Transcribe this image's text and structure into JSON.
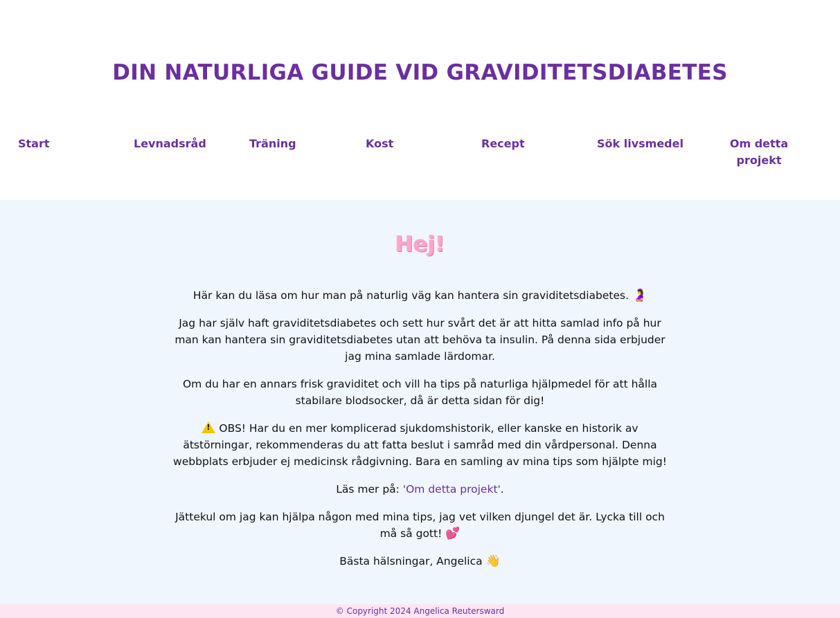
{
  "header": {
    "title": "DIN NATURLIGA GUIDE VID GRAVIDITETSDIABETES"
  },
  "nav": {
    "items": [
      {
        "label": "Start"
      },
      {
        "label": "Levnadsråd"
      },
      {
        "label": "Träning"
      },
      {
        "label": "Kost"
      },
      {
        "label": "Recept"
      },
      {
        "label": "Sök livsmedel"
      },
      {
        "label": "Om detta projekt"
      }
    ]
  },
  "main": {
    "greeting": "Hej!",
    "p1": "Här kan du läsa om hur man på naturlig väg kan hantera sin graviditetsdiabetes.",
    "p1_emoji": "🤰",
    "p2": "Jag har själv haft graviditetsdiabetes och sett hur svårt det är att hitta samlad info på hur man kan hantera sin graviditetsdiabetes utan att behöva ta insulin. På denna sida erbjuder jag mina samlade lärdomar.",
    "p3": "Om du har en annars frisk graviditet och vill ha tips på naturliga hjälpmedel för att hålla stabilare blodsocker, då är detta sidan för dig!",
    "p4": "OBS! Har du en mer komplicerad sjukdomshistorik, eller kanske en historik av ätstörningar, rekommenderas du att fatta beslut i samråd med din vårdpersonal. Denna webbplats erbjuder ej medicinsk rådgivning. Bara en samling av mina tips som hjälpte mig!",
    "p4_icon": "warning-icon",
    "p5_prefix": "Läs mer på: ",
    "p5_link": "'Om detta projekt'",
    "p5_suffix": ".",
    "p6": "Jättekul om jag kan hjälpa någon med mina tips, jag vet vilken djungel det är. Lycka till och må så gott!",
    "p6_emoji": "💕",
    "p7": "Bästa hälsningar, Angelica",
    "p7_emoji": "👋"
  },
  "footer": {
    "copyright": "© Copyright 2024 Angelica Reutersward"
  },
  "colors": {
    "brand_purple": "#6b2fa0",
    "greeting_pink": "#f9a8c9",
    "content_bg": "#eff6fe",
    "footer_bg": "#fde6f2"
  }
}
